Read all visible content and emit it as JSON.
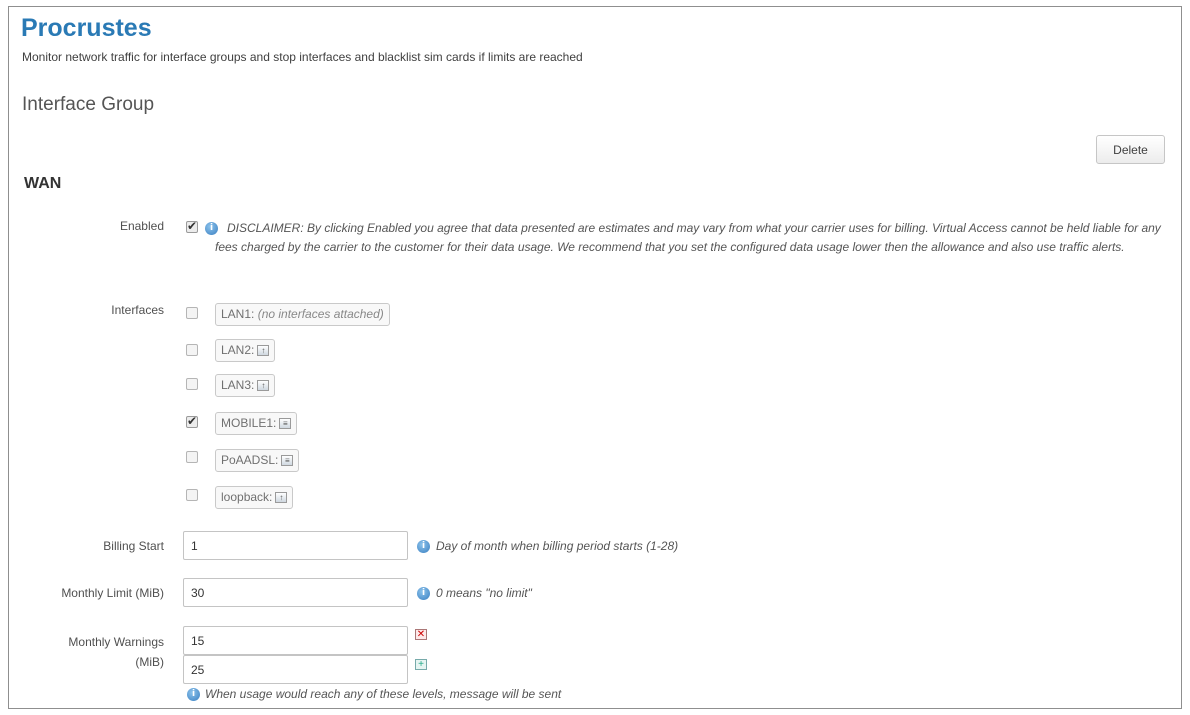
{
  "header": {
    "title": "Procrustes",
    "description": "Monitor network traffic for interface groups and stop interfaces and blacklist sim cards if limits are reached"
  },
  "section": {
    "title": "Interface Group"
  },
  "toolbar": {
    "delete_label": "Delete"
  },
  "group": {
    "name": "WAN",
    "enabled": {
      "label": "Enabled",
      "checked": true,
      "disclaimer": "DISCLAIMER: By clicking Enabled you agree that data presented are estimates and may vary from what your carrier uses for billing. Virtual Access cannot be held liable for any fees charged by the carrier to the customer for their data usage. We recommend that you set the configured data usage lower then the allowance and also use traffic alerts."
    },
    "interfaces": {
      "label": "Interfaces",
      "items": [
        {
          "name": "LAN1:",
          "note": "(no interfaces attached)",
          "checked": false,
          "icon": ""
        },
        {
          "name": "LAN2:",
          "note": "",
          "checked": false,
          "icon": "ethernet-icon"
        },
        {
          "name": "LAN3:",
          "note": "",
          "checked": false,
          "icon": "ethernet-icon"
        },
        {
          "name": "MOBILE1:",
          "note": "",
          "checked": true,
          "icon": "mobile-icon"
        },
        {
          "name": "PoAADSL:",
          "note": "",
          "checked": false,
          "icon": "mobile-icon"
        },
        {
          "name": "loopback:",
          "note": "",
          "checked": false,
          "icon": "ethernet-icon"
        }
      ]
    },
    "billing_start": {
      "label": "Billing Start",
      "value": "1",
      "hint": "Day of month when billing period starts (1-28)"
    },
    "monthly_limit": {
      "label": "Monthly Limit (MiB)",
      "value": "30",
      "hint": "0 means \"no limit\""
    },
    "monthly_warnings": {
      "label_line1": "Monthly Warnings",
      "label_line2": "(MiB)",
      "values": [
        "15",
        "25"
      ],
      "hint": "When usage would reach any of these levels, message will be sent"
    }
  }
}
